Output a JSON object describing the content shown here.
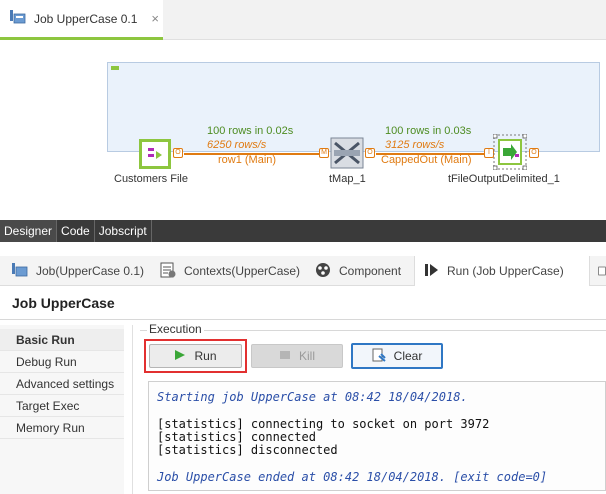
{
  "editor_tab": {
    "title": "Job UpperCase 0.1",
    "close": "×"
  },
  "canvas": {
    "components": [
      {
        "name": "Customers File"
      },
      {
        "name": "tMap_1"
      },
      {
        "name": "tFileOutputDelimited_1"
      }
    ],
    "connections": [
      {
        "stats": "100 rows in 0.02s",
        "rate": "6250 rows/s",
        "label": "row1 (Main)"
      },
      {
        "stats": "100 rows in 0.03s",
        "rate": "3125 rows/s",
        "label": "CappedOut (Main)"
      }
    ],
    "ports": {
      "out": "O",
      "map_in": "M",
      "map_out": "O",
      "file_in": "I",
      "file_out": "O"
    }
  },
  "view_tabs": [
    "Designer",
    "Code",
    "Jobscript"
  ],
  "panel_tabs": [
    {
      "label": "Job(UpperCase 0.1)"
    },
    {
      "label": "Contexts(UpperCase)"
    },
    {
      "label": "Component"
    },
    {
      "label": "Run (Job UpperCase)"
    }
  ],
  "panel_title": "Job UpperCase",
  "left_nav": [
    "Basic Run",
    "Debug Run",
    "Advanced settings",
    "Target Exec",
    "Memory Run"
  ],
  "execution": {
    "group_label": "Execution",
    "run_label": "Run",
    "kill_label": "Kill",
    "clear_label": "Clear"
  },
  "console": {
    "lines": [
      "Starting job UpperCase at 08:42 18/04/2018.",
      "[statistics] connecting to socket on port 3972",
      "[statistics] connected",
      "[statistics] disconnected",
      "Job UpperCase ended at 08:42 18/04/2018. [exit code=0]"
    ]
  },
  "colors": {
    "accent_green": "#8dc63f",
    "connection_orange": "#e07b12",
    "highlight_red": "#e23030",
    "clear_blue": "#2f77c4"
  },
  "icons": {
    "job_tab": "job-icon",
    "customers_file": "file-input-icon",
    "tmap": "tmap-icon",
    "file_output": "file-output-icon",
    "job_panel": "job-settings-icon",
    "contexts": "contexts-icon",
    "component": "component-icon",
    "run_panel": "run-panel-icon",
    "run": "play-icon",
    "kill": "kill-icon",
    "clear": "clear-icon"
  }
}
